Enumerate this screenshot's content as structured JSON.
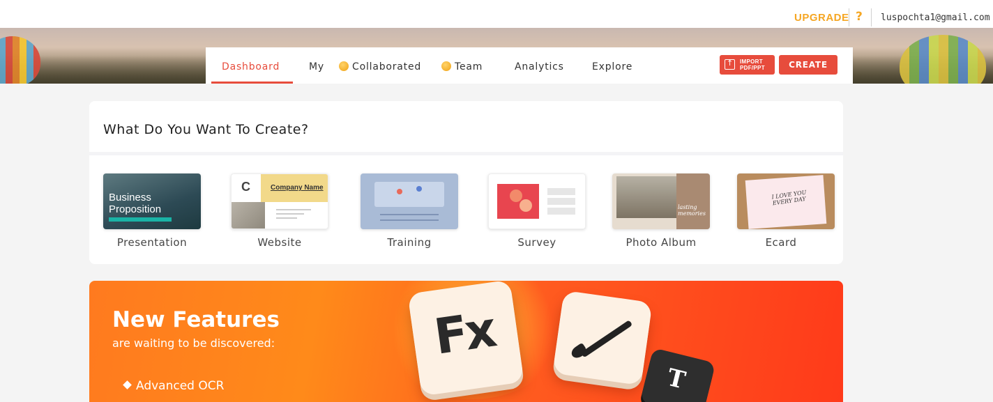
{
  "header": {
    "upgrade_label": "UPGRADE",
    "help_label": "?",
    "user_email": "luspochta1@gmail.com"
  },
  "nav": {
    "items": [
      {
        "label": "Dashboard",
        "active": true
      },
      {
        "label": "My"
      },
      {
        "label": "Collaborated",
        "icon": "coin-icon"
      },
      {
        "label": "Team",
        "icon": "coin-icon"
      },
      {
        "label": "Analytics"
      },
      {
        "label": "Explore"
      }
    ],
    "import_label": "IMPORT\nPDF/PPT",
    "create_label": "CREATE"
  },
  "create_section": {
    "title": "What Do You Want To Create?",
    "templates": [
      {
        "label": "Presentation",
        "thumb_text": "Business\nProposition"
      },
      {
        "label": "Website",
        "thumb_text": "Company Name",
        "thumb_logo": "C"
      },
      {
        "label": "Training"
      },
      {
        "label": "Survey"
      },
      {
        "label": "Photo Album",
        "thumb_text": "lasting\nmemories"
      },
      {
        "label": "Ecard",
        "thumb_text": "I LOVE YOU\nEVERY DAY"
      }
    ]
  },
  "features": {
    "title": "New Features",
    "subtitle": "are waiting to be discovered:",
    "bullets": [
      "Advanced OCR"
    ],
    "key_fx": "Fx",
    "key_t": "T"
  },
  "colors": {
    "accent": "#e74c3c",
    "upgrade": "#f5a623",
    "feature_bg": "#ff6a1f"
  }
}
